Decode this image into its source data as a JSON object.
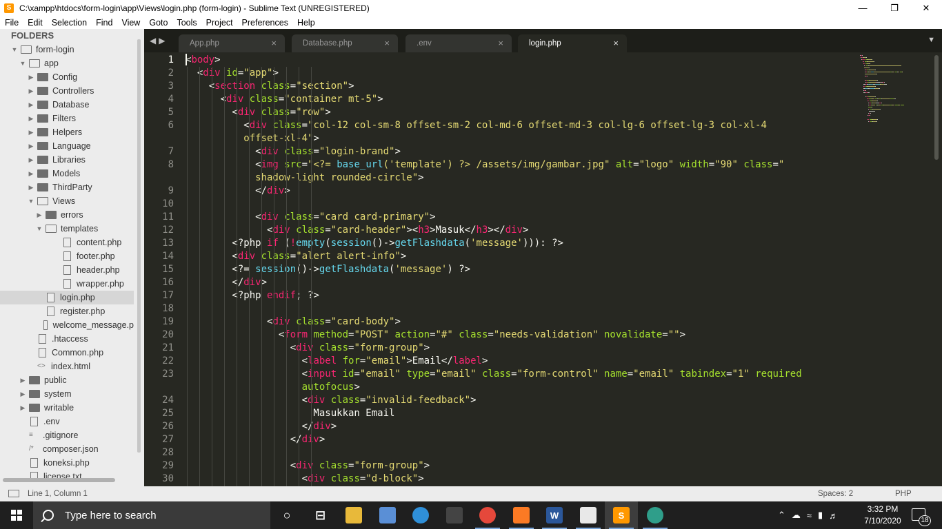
{
  "window": {
    "title": "C:\\xampp\\htdocs\\form-login\\app\\Views\\login.php (form-login) - Sublime Text (UNREGISTERED)",
    "app_icon_letter": "S"
  },
  "menu": [
    "File",
    "Edit",
    "Selection",
    "Find",
    "View",
    "Goto",
    "Tools",
    "Project",
    "Preferences",
    "Help"
  ],
  "sidebar": {
    "title": "FOLDERS",
    "items": [
      {
        "label": "form-login",
        "depth": 0,
        "type": "folder-open",
        "expanded": true
      },
      {
        "label": "app",
        "depth": 1,
        "type": "folder-open",
        "expanded": true
      },
      {
        "label": "Config",
        "depth": 2,
        "type": "folder"
      },
      {
        "label": "Controllers",
        "depth": 2,
        "type": "folder"
      },
      {
        "label": "Database",
        "depth": 2,
        "type": "folder"
      },
      {
        "label": "Filters",
        "depth": 2,
        "type": "folder"
      },
      {
        "label": "Helpers",
        "depth": 2,
        "type": "folder"
      },
      {
        "label": "Language",
        "depth": 2,
        "type": "folder"
      },
      {
        "label": "Libraries",
        "depth": 2,
        "type": "folder"
      },
      {
        "label": "Models",
        "depth": 2,
        "type": "folder"
      },
      {
        "label": "ThirdParty",
        "depth": 2,
        "type": "folder"
      },
      {
        "label": "Views",
        "depth": 2,
        "type": "folder-open",
        "expanded": true
      },
      {
        "label": "errors",
        "depth": 3,
        "type": "folder"
      },
      {
        "label": "templates",
        "depth": 3,
        "type": "folder-open",
        "expanded": true
      },
      {
        "label": "content.php",
        "depth": 4,
        "type": "file"
      },
      {
        "label": "footer.php",
        "depth": 4,
        "type": "file"
      },
      {
        "label": "header.php",
        "depth": 4,
        "type": "file"
      },
      {
        "label": "wrapper.php",
        "depth": 4,
        "type": "file"
      },
      {
        "label": "login.php",
        "depth": 3,
        "type": "file",
        "selected": true
      },
      {
        "label": "register.php",
        "depth": 3,
        "type": "file"
      },
      {
        "label": "welcome_message.p",
        "depth": 3,
        "type": "file"
      },
      {
        "label": ".htaccess",
        "depth": 2,
        "type": "file"
      },
      {
        "label": "Common.php",
        "depth": 2,
        "type": "file"
      },
      {
        "label": "index.html",
        "depth": 2,
        "type": "code"
      },
      {
        "label": "public",
        "depth": 1,
        "type": "folder"
      },
      {
        "label": "system",
        "depth": 1,
        "type": "folder"
      },
      {
        "label": "writable",
        "depth": 1,
        "type": "folder"
      },
      {
        "label": ".env",
        "depth": 1,
        "type": "file"
      },
      {
        "label": ".gitignore",
        "depth": 1,
        "type": "list"
      },
      {
        "label": "composer.json",
        "depth": 1,
        "type": "json"
      },
      {
        "label": "koneksi.php",
        "depth": 1,
        "type": "file"
      },
      {
        "label": "license.txt",
        "depth": 1,
        "type": "file"
      }
    ]
  },
  "tabs": [
    {
      "label": "App.php",
      "active": false
    },
    {
      "label": "Database.php",
      "active": false
    },
    {
      "label": ".env",
      "active": false
    },
    {
      "label": "login.php",
      "active": true
    }
  ],
  "tab_close_glyph": "×",
  "editor": {
    "line_numbers": [
      "1",
      "2",
      "3",
      "4",
      "5",
      "6",
      "",
      "7",
      "8",
      "",
      "9",
      "10",
      "11",
      "12",
      "13",
      "14",
      "15",
      "16",
      "17",
      "18",
      "19",
      "20",
      "21",
      "22",
      "23",
      "",
      "24",
      "25",
      "26",
      "27",
      "28",
      "29",
      "30"
    ],
    "code_lines": [
      [
        [
          "t",
          "<"
        ],
        [
          "tag",
          "body"
        ],
        [
          "t",
          ">"
        ]
      ],
      [
        [
          "t",
          "  <"
        ],
        [
          "tag",
          "div"
        ],
        [
          "t",
          " "
        ],
        [
          "attr",
          "id"
        ],
        [
          "t",
          "="
        ],
        [
          "str",
          "\"app\""
        ],
        [
          "t",
          ">"
        ]
      ],
      [
        [
          "t",
          "    <"
        ],
        [
          "tag",
          "section"
        ],
        [
          "t",
          " "
        ],
        [
          "attr",
          "class"
        ],
        [
          "t",
          "="
        ],
        [
          "str",
          "\"section\""
        ],
        [
          "t",
          ">"
        ]
      ],
      [
        [
          "t",
          "      <"
        ],
        [
          "tag",
          "div"
        ],
        [
          "t",
          " "
        ],
        [
          "attr",
          "class"
        ],
        [
          "t",
          "="
        ],
        [
          "str",
          "\"container mt-5\""
        ],
        [
          "t",
          ">"
        ]
      ],
      [
        [
          "t",
          "        <"
        ],
        [
          "tag",
          "div"
        ],
        [
          "t",
          " "
        ],
        [
          "attr",
          "class"
        ],
        [
          "t",
          "="
        ],
        [
          "str",
          "\"row\""
        ],
        [
          "t",
          ">"
        ]
      ],
      [
        [
          "t",
          "          <"
        ],
        [
          "tag",
          "div"
        ],
        [
          "t",
          " "
        ],
        [
          "attr",
          "class"
        ],
        [
          "t",
          "="
        ],
        [
          "str",
          "\"col-12 col-sm-8 offset-sm-2 col-md-6 offset-md-3 col-lg-6 offset-lg-3 col-xl-4"
        ]
      ],
      [
        [
          "str",
          "          offset-xl-4\""
        ],
        [
          "t",
          ">"
        ]
      ],
      [
        [
          "t",
          "            <"
        ],
        [
          "tag",
          "div"
        ],
        [
          "t",
          " "
        ],
        [
          "attr",
          "class"
        ],
        [
          "t",
          "="
        ],
        [
          "str",
          "\"login-brand\""
        ],
        [
          "t",
          ">"
        ]
      ],
      [
        [
          "t",
          "            <"
        ],
        [
          "tag",
          "img"
        ],
        [
          "t",
          " "
        ],
        [
          "attr",
          "src"
        ],
        [
          "t",
          "="
        ],
        [
          "str",
          "\"<?= "
        ],
        [
          "fn",
          "base_url"
        ],
        [
          "str",
          "("
        ],
        [
          "str2",
          "'template'"
        ],
        [
          "str",
          ") ?> /assets/img/gambar.jpg\""
        ],
        [
          "t",
          " "
        ],
        [
          "attr",
          "alt"
        ],
        [
          "t",
          "="
        ],
        [
          "str",
          "\"logo\""
        ],
        [
          "t",
          " "
        ],
        [
          "attr",
          "width"
        ],
        [
          "t",
          "="
        ],
        [
          "str",
          "\"90\""
        ],
        [
          "t",
          " "
        ],
        [
          "attr",
          "class"
        ],
        [
          "t",
          "="
        ],
        [
          "str",
          "\""
        ]
      ],
      [
        [
          "str",
          "            shadow-light rounded-circle\""
        ],
        [
          "t",
          ">"
        ]
      ],
      [
        [
          "t",
          "            </"
        ],
        [
          "tag",
          "div"
        ],
        [
          "t",
          ">"
        ]
      ],
      [
        [
          "t",
          ""
        ]
      ],
      [
        [
          "t",
          "            <"
        ],
        [
          "tag",
          "div"
        ],
        [
          "t",
          " "
        ],
        [
          "attr",
          "class"
        ],
        [
          "t",
          "="
        ],
        [
          "str",
          "\"card card-primary\""
        ],
        [
          "t",
          ">"
        ]
      ],
      [
        [
          "t",
          "              <"
        ],
        [
          "tag",
          "div"
        ],
        [
          "t",
          " "
        ],
        [
          "attr",
          "class"
        ],
        [
          "t",
          "="
        ],
        [
          "str",
          "\"card-header\""
        ],
        [
          "t",
          ">"
        ],
        [
          "t",
          "<"
        ],
        [
          "tag",
          "h3"
        ],
        [
          "t",
          ">Masuk</"
        ],
        [
          "tag",
          "h3"
        ],
        [
          "t",
          "></"
        ],
        [
          "tag",
          "div"
        ],
        [
          "t",
          ">"
        ]
      ],
      [
        [
          "t",
          "        <?php "
        ],
        [
          "kw",
          "if"
        ],
        [
          "t",
          " ("
        ],
        [
          "kw",
          "!"
        ],
        [
          "fn",
          "empty"
        ],
        [
          "t",
          "("
        ],
        [
          "fn",
          "session"
        ],
        [
          "t",
          "()->"
        ],
        [
          "fn",
          "getFlashdata"
        ],
        [
          "t",
          "("
        ],
        [
          "str2",
          "'message'"
        ],
        [
          "t",
          ")))"
        ],
        [
          "t",
          ": ?>"
        ]
      ],
      [
        [
          "t",
          "        <"
        ],
        [
          "tag",
          "div"
        ],
        [
          "t",
          " "
        ],
        [
          "attr",
          "class"
        ],
        [
          "t",
          "="
        ],
        [
          "str",
          "\"alert alert-info\""
        ],
        [
          "t",
          ">"
        ]
      ],
      [
        [
          "t",
          "        <?= "
        ],
        [
          "fn",
          "session"
        ],
        [
          "t",
          "()->"
        ],
        [
          "fn",
          "getFlashdata"
        ],
        [
          "t",
          "("
        ],
        [
          "str2",
          "'message'"
        ],
        [
          "t",
          ") ?>"
        ]
      ],
      [
        [
          "t",
          "        </"
        ],
        [
          "tag",
          "div"
        ],
        [
          "t",
          ">"
        ]
      ],
      [
        [
          "t",
          "        <?php "
        ],
        [
          "kw",
          "endif"
        ],
        [
          "t",
          "; ?>"
        ]
      ],
      [
        [
          "t",
          ""
        ]
      ],
      [
        [
          "t",
          "              <"
        ],
        [
          "tag",
          "div"
        ],
        [
          "t",
          " "
        ],
        [
          "attr",
          "class"
        ],
        [
          "t",
          "="
        ],
        [
          "str",
          "\"card-body\""
        ],
        [
          "t",
          ">"
        ]
      ],
      [
        [
          "t",
          "                <"
        ],
        [
          "tag",
          "form"
        ],
        [
          "t",
          " "
        ],
        [
          "attr",
          "method"
        ],
        [
          "t",
          "="
        ],
        [
          "str",
          "\"POST\""
        ],
        [
          "t",
          " "
        ],
        [
          "attr",
          "action"
        ],
        [
          "t",
          "="
        ],
        [
          "str",
          "\"#\""
        ],
        [
          "t",
          " "
        ],
        [
          "attr",
          "class"
        ],
        [
          "t",
          "="
        ],
        [
          "str",
          "\"needs-validation\""
        ],
        [
          "t",
          " "
        ],
        [
          "attr",
          "novalidate"
        ],
        [
          "t",
          "="
        ],
        [
          "str",
          "\"\""
        ],
        [
          "t",
          ">"
        ]
      ],
      [
        [
          "t",
          "                  <"
        ],
        [
          "tag",
          "div"
        ],
        [
          "t",
          " "
        ],
        [
          "attr",
          "class"
        ],
        [
          "t",
          "="
        ],
        [
          "str",
          "\"form-group\""
        ],
        [
          "t",
          ">"
        ]
      ],
      [
        [
          "t",
          "                    <"
        ],
        [
          "tag",
          "label"
        ],
        [
          "t",
          " "
        ],
        [
          "attr",
          "for"
        ],
        [
          "t",
          "="
        ],
        [
          "str",
          "\"email\""
        ],
        [
          "t",
          ">Email</"
        ],
        [
          "tag",
          "label"
        ],
        [
          "t",
          ">"
        ]
      ],
      [
        [
          "t",
          "                    <"
        ],
        [
          "tag",
          "input"
        ],
        [
          "t",
          " "
        ],
        [
          "attr",
          "id"
        ],
        [
          "t",
          "="
        ],
        [
          "str",
          "\"email\""
        ],
        [
          "t",
          " "
        ],
        [
          "attr",
          "type"
        ],
        [
          "t",
          "="
        ],
        [
          "str",
          "\"email\""
        ],
        [
          "t",
          " "
        ],
        [
          "attr",
          "class"
        ],
        [
          "t",
          "="
        ],
        [
          "str",
          "\"form-control\""
        ],
        [
          "t",
          " "
        ],
        [
          "attr",
          "name"
        ],
        [
          "t",
          "="
        ],
        [
          "str",
          "\"email\""
        ],
        [
          "t",
          " "
        ],
        [
          "attr",
          "tabindex"
        ],
        [
          "t",
          "="
        ],
        [
          "str",
          "\"1\""
        ],
        [
          "t",
          " "
        ],
        [
          "attr",
          "required"
        ]
      ],
      [
        [
          "attr",
          "                    autofocus"
        ],
        [
          "t",
          ">"
        ]
      ],
      [
        [
          "t",
          "                    <"
        ],
        [
          "tag",
          "div"
        ],
        [
          "t",
          " "
        ],
        [
          "attr",
          "class"
        ],
        [
          "t",
          "="
        ],
        [
          "str",
          "\"invalid-feedback\""
        ],
        [
          "t",
          ">"
        ]
      ],
      [
        [
          "t",
          "                      Masukkan Email"
        ]
      ],
      [
        [
          "t",
          "                    </"
        ],
        [
          "tag",
          "div"
        ],
        [
          "t",
          ">"
        ]
      ],
      [
        [
          "t",
          "                  </"
        ],
        [
          "tag",
          "div"
        ],
        [
          "t",
          ">"
        ]
      ],
      [
        [
          "t",
          ""
        ]
      ],
      [
        [
          "t",
          "                  <"
        ],
        [
          "tag",
          "div"
        ],
        [
          "t",
          " "
        ],
        [
          "attr",
          "class"
        ],
        [
          "t",
          "="
        ],
        [
          "str",
          "\"form-group\""
        ],
        [
          "t",
          ">"
        ]
      ],
      [
        [
          "t",
          "                    <"
        ],
        [
          "tag",
          "div"
        ],
        [
          "t",
          " "
        ],
        [
          "attr",
          "class"
        ],
        [
          "t",
          "="
        ],
        [
          "str",
          "\"d-block\""
        ],
        [
          "t",
          ">"
        ]
      ]
    ]
  },
  "statusbar": {
    "position": "Line 1, Column 1",
    "spaces": "Spaces: 2",
    "syntax": "PHP"
  },
  "taskbar": {
    "search_placeholder": "Type here to search",
    "time": "3:32 PM",
    "date": "7/10/2020",
    "notification_count": "18",
    "apps": [
      {
        "name": "task-view",
        "label": "○"
      },
      {
        "name": "timeline",
        "label": "⊟"
      },
      {
        "name": "file-explorer",
        "label": ""
      },
      {
        "name": "virtualbox",
        "label": ""
      },
      {
        "name": "edge",
        "label": ""
      },
      {
        "name": "store",
        "label": ""
      },
      {
        "name": "chrome",
        "label": ""
      },
      {
        "name": "xampp",
        "label": ""
      },
      {
        "name": "word",
        "label": "W"
      },
      {
        "name": "java",
        "label": ""
      },
      {
        "name": "sublime",
        "label": "S"
      },
      {
        "name": "edge-2",
        "label": ""
      }
    ]
  },
  "colors": {
    "editor_bg": "#272822",
    "tag": "#f92672",
    "attr": "#a6e22e",
    "string": "#e6db74",
    "function": "#66d9ef",
    "keyword": "#f92672",
    "text": "#f8f8f2"
  }
}
